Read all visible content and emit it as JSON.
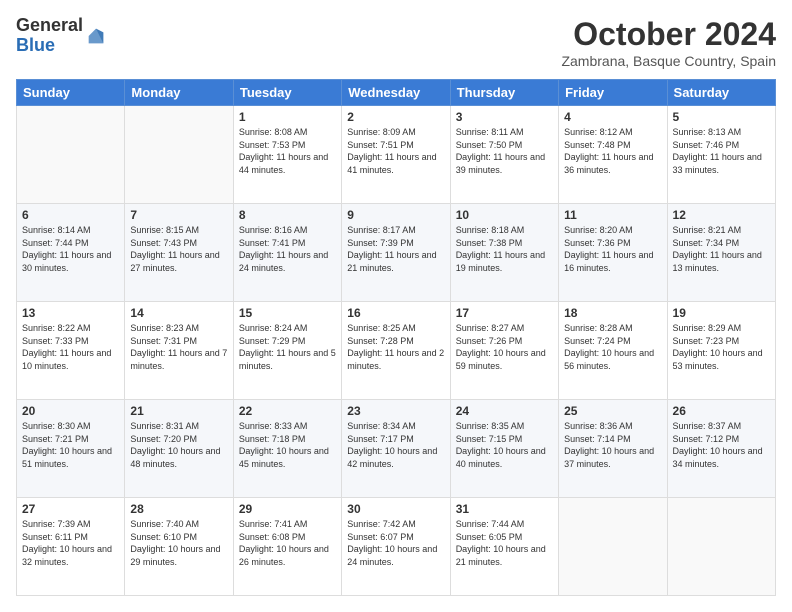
{
  "logo": {
    "general": "General",
    "blue": "Blue"
  },
  "header": {
    "month": "October 2024",
    "location": "Zambrana, Basque Country, Spain"
  },
  "weekdays": [
    "Sunday",
    "Monday",
    "Tuesday",
    "Wednesday",
    "Thursday",
    "Friday",
    "Saturday"
  ],
  "weeks": [
    [
      {
        "day": "",
        "info": ""
      },
      {
        "day": "",
        "info": ""
      },
      {
        "day": "1",
        "info": "Sunrise: 8:08 AM\nSunset: 7:53 PM\nDaylight: 11 hours and 44 minutes."
      },
      {
        "day": "2",
        "info": "Sunrise: 8:09 AM\nSunset: 7:51 PM\nDaylight: 11 hours and 41 minutes."
      },
      {
        "day": "3",
        "info": "Sunrise: 8:11 AM\nSunset: 7:50 PM\nDaylight: 11 hours and 39 minutes."
      },
      {
        "day": "4",
        "info": "Sunrise: 8:12 AM\nSunset: 7:48 PM\nDaylight: 11 hours and 36 minutes."
      },
      {
        "day": "5",
        "info": "Sunrise: 8:13 AM\nSunset: 7:46 PM\nDaylight: 11 hours and 33 minutes."
      }
    ],
    [
      {
        "day": "6",
        "info": "Sunrise: 8:14 AM\nSunset: 7:44 PM\nDaylight: 11 hours and 30 minutes."
      },
      {
        "day": "7",
        "info": "Sunrise: 8:15 AM\nSunset: 7:43 PM\nDaylight: 11 hours and 27 minutes."
      },
      {
        "day": "8",
        "info": "Sunrise: 8:16 AM\nSunset: 7:41 PM\nDaylight: 11 hours and 24 minutes."
      },
      {
        "day": "9",
        "info": "Sunrise: 8:17 AM\nSunset: 7:39 PM\nDaylight: 11 hours and 21 minutes."
      },
      {
        "day": "10",
        "info": "Sunrise: 8:18 AM\nSunset: 7:38 PM\nDaylight: 11 hours and 19 minutes."
      },
      {
        "day": "11",
        "info": "Sunrise: 8:20 AM\nSunset: 7:36 PM\nDaylight: 11 hours and 16 minutes."
      },
      {
        "day": "12",
        "info": "Sunrise: 8:21 AM\nSunset: 7:34 PM\nDaylight: 11 hours and 13 minutes."
      }
    ],
    [
      {
        "day": "13",
        "info": "Sunrise: 8:22 AM\nSunset: 7:33 PM\nDaylight: 11 hours and 10 minutes."
      },
      {
        "day": "14",
        "info": "Sunrise: 8:23 AM\nSunset: 7:31 PM\nDaylight: 11 hours and 7 minutes."
      },
      {
        "day": "15",
        "info": "Sunrise: 8:24 AM\nSunset: 7:29 PM\nDaylight: 11 hours and 5 minutes."
      },
      {
        "day": "16",
        "info": "Sunrise: 8:25 AM\nSunset: 7:28 PM\nDaylight: 11 hours and 2 minutes."
      },
      {
        "day": "17",
        "info": "Sunrise: 8:27 AM\nSunset: 7:26 PM\nDaylight: 10 hours and 59 minutes."
      },
      {
        "day": "18",
        "info": "Sunrise: 8:28 AM\nSunset: 7:24 PM\nDaylight: 10 hours and 56 minutes."
      },
      {
        "day": "19",
        "info": "Sunrise: 8:29 AM\nSunset: 7:23 PM\nDaylight: 10 hours and 53 minutes."
      }
    ],
    [
      {
        "day": "20",
        "info": "Sunrise: 8:30 AM\nSunset: 7:21 PM\nDaylight: 10 hours and 51 minutes."
      },
      {
        "day": "21",
        "info": "Sunrise: 8:31 AM\nSunset: 7:20 PM\nDaylight: 10 hours and 48 minutes."
      },
      {
        "day": "22",
        "info": "Sunrise: 8:33 AM\nSunset: 7:18 PM\nDaylight: 10 hours and 45 minutes."
      },
      {
        "day": "23",
        "info": "Sunrise: 8:34 AM\nSunset: 7:17 PM\nDaylight: 10 hours and 42 minutes."
      },
      {
        "day": "24",
        "info": "Sunrise: 8:35 AM\nSunset: 7:15 PM\nDaylight: 10 hours and 40 minutes."
      },
      {
        "day": "25",
        "info": "Sunrise: 8:36 AM\nSunset: 7:14 PM\nDaylight: 10 hours and 37 minutes."
      },
      {
        "day": "26",
        "info": "Sunrise: 8:37 AM\nSunset: 7:12 PM\nDaylight: 10 hours and 34 minutes."
      }
    ],
    [
      {
        "day": "27",
        "info": "Sunrise: 7:39 AM\nSunset: 6:11 PM\nDaylight: 10 hours and 32 minutes."
      },
      {
        "day": "28",
        "info": "Sunrise: 7:40 AM\nSunset: 6:10 PM\nDaylight: 10 hours and 29 minutes."
      },
      {
        "day": "29",
        "info": "Sunrise: 7:41 AM\nSunset: 6:08 PM\nDaylight: 10 hours and 26 minutes."
      },
      {
        "day": "30",
        "info": "Sunrise: 7:42 AM\nSunset: 6:07 PM\nDaylight: 10 hours and 24 minutes."
      },
      {
        "day": "31",
        "info": "Sunrise: 7:44 AM\nSunset: 6:05 PM\nDaylight: 10 hours and 21 minutes."
      },
      {
        "day": "",
        "info": ""
      },
      {
        "day": "",
        "info": ""
      }
    ]
  ]
}
